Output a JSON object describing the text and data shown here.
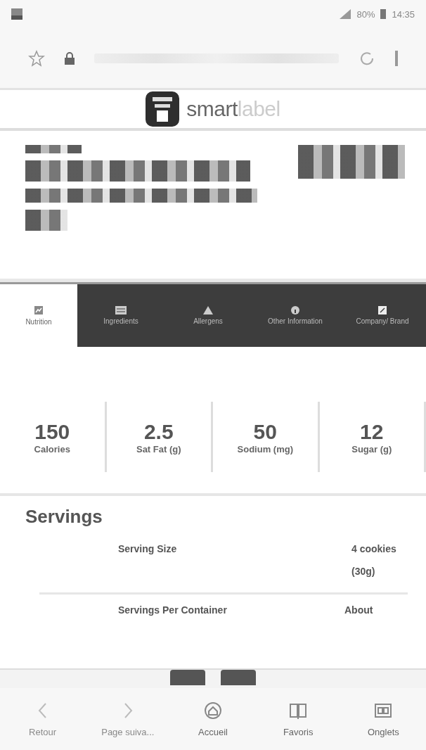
{
  "status_bar": {
    "battery": "80%",
    "time": "14:35"
  },
  "brand": {
    "first": "smart",
    "second": "label"
  },
  "tabs": [
    {
      "label": "Nutrition",
      "selected": true
    },
    {
      "label": "Ingredients",
      "selected": false
    },
    {
      "label": "Allergens",
      "selected": false
    },
    {
      "label": "Other Information",
      "selected": false
    },
    {
      "label": "Company/ Brand",
      "selected": false
    }
  ],
  "stats": [
    {
      "value": "150",
      "label": "Calories"
    },
    {
      "value": "2.5",
      "label": "Sat Fat (g)"
    },
    {
      "value": "50",
      "label": "Sodium (mg)"
    },
    {
      "value": "12",
      "label": "Sugar (g)"
    }
  ],
  "servings": {
    "title": "Servings",
    "rows": [
      {
        "label": "Serving Size",
        "value": "4 cookies (30g)"
      },
      {
        "label": "Servings Per Container",
        "value": "About"
      }
    ]
  },
  "bottom_nav": [
    {
      "label": "Retour",
      "disabled": true
    },
    {
      "label": "Page suiva...",
      "disabled": true
    },
    {
      "label": "Accueil",
      "disabled": false
    },
    {
      "label": "Favoris",
      "disabled": false
    },
    {
      "label": "Onglets",
      "disabled": false
    }
  ]
}
